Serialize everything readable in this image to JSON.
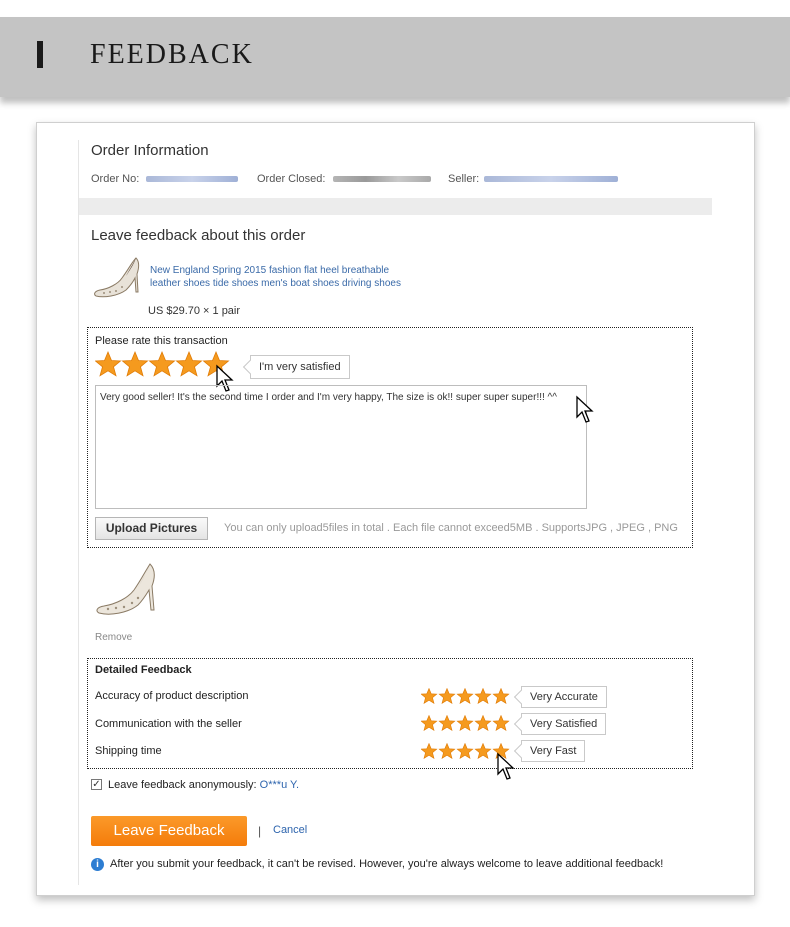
{
  "banner": {
    "title": "FEEDBACK"
  },
  "order": {
    "heading": "Order Information",
    "order_no_label": "Order No:",
    "order_closed_label": "Order Closed:",
    "seller_label": "Seller:"
  },
  "leave": {
    "heading": "Leave feedback about this order",
    "product_line1": "New England Spring 2015 fashion flat heel breathable",
    "product_line2": "leather shoes tide shoes men's boat shoes driving shoes",
    "price": "US $29.70 × 1 pair"
  },
  "rating": {
    "label": "Please rate this transaction",
    "stars": 5,
    "tooltip": "I'm very satisfied",
    "comment": "Very good seller! It's the second time I order and I'm very happy, The size is ok!! super super super!!! ^^",
    "upload_button": "Upload Pictures",
    "upload_hint": "You can only upload5files in total . Each file cannot exceed5MB . SupportsJPG , JPEG , PNG",
    "remove": "Remove"
  },
  "detailed": {
    "heading": "Detailed Feedback",
    "rows": [
      {
        "label": "Accuracy of product description",
        "stars": 5,
        "tooltip": "Very Accurate"
      },
      {
        "label": "Communication with the seller",
        "stars": 5,
        "tooltip": "Very Satisfied"
      },
      {
        "label": "Shipping time",
        "stars": 5,
        "tooltip": "Very Fast"
      }
    ]
  },
  "anonymous": {
    "label": "Leave feedback anonymously:",
    "name": "O***u Y.",
    "checked": true
  },
  "actions": {
    "leave_button": "Leave Feedback",
    "separator": "|",
    "cancel": "Cancel"
  },
  "notice": "After you submit your feedback, it can't be revised. However, you're always welcome to leave additional feedback!",
  "colors": {
    "accent": "#f47c0a",
    "star": "#f59a1e",
    "link": "#2d64ad",
    "banner": "#c4c4c4"
  }
}
